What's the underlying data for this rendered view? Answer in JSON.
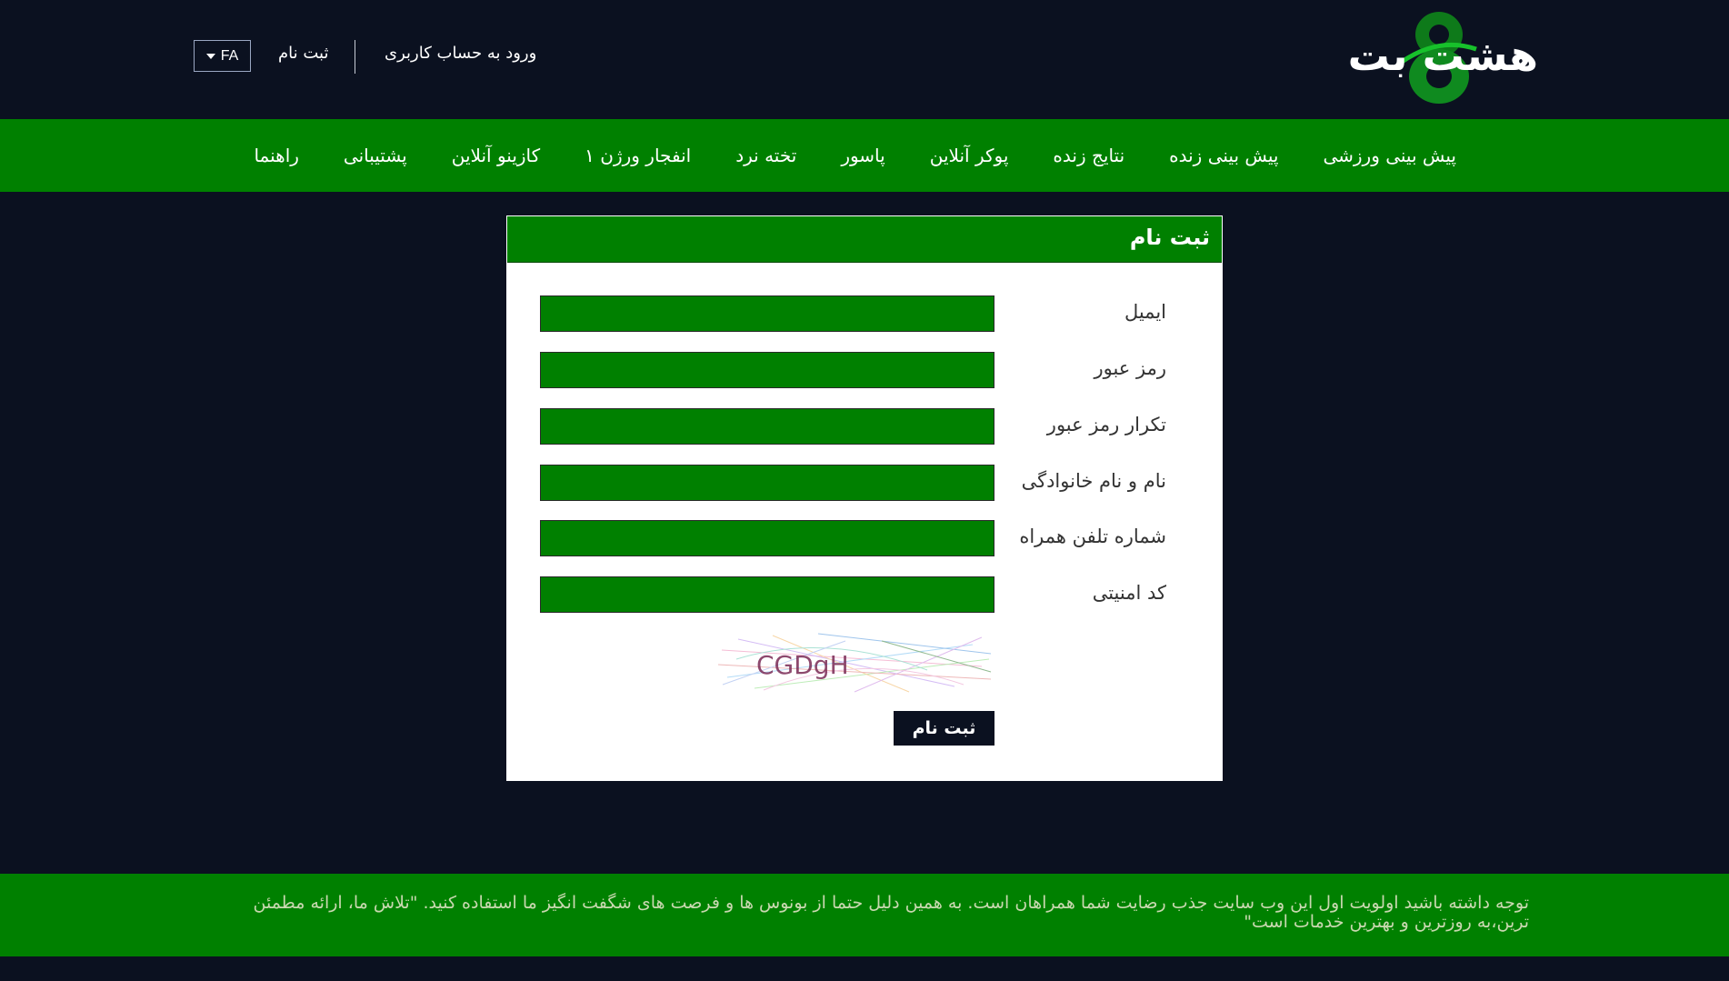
{
  "header": {
    "logo_text": "هشت بت",
    "lang": "FA",
    "login_link": "ورود به حساب کاربری",
    "register_link": "ثبت نام"
  },
  "nav": {
    "items": [
      "پیش بینی ورزشی",
      "پیش بینی زنده",
      "نتایج زنده",
      "پوکر آنلاین",
      "پاسور",
      "تخته نرد",
      "انفجار ورژن ۱",
      "کازینو آنلاین",
      "پشتیبانی",
      "راهنما"
    ]
  },
  "form": {
    "title": "ثبت نام",
    "fields": [
      {
        "label": "ایمیل",
        "value": ""
      },
      {
        "label": "رمز عبور",
        "value": ""
      },
      {
        "label": "تکرار رمز عبور",
        "value": ""
      },
      {
        "label": "نام و نام خانوادگی",
        "value": ""
      },
      {
        "label": "شماره تلفن همراه",
        "value": ""
      },
      {
        "label": "کد امنیتی",
        "value": ""
      }
    ],
    "captcha_text": "CGDgH",
    "submit_label": "ثبت نام"
  },
  "notice": {
    "text": "توجه داشته باشید اولویت اول این وب سایت جذب رضایت شما همراهان است. به همین دلیل حتما از بونوس ها و فرصت های شگفت انگیز ما استفاده کنید. \"تلاش ما، ارائه مطمئن ترین،به روزترین و بهترین خدمات است\""
  },
  "colors": {
    "background": "#0b1120",
    "brand_green": "#008000",
    "card": "#ffffff"
  }
}
